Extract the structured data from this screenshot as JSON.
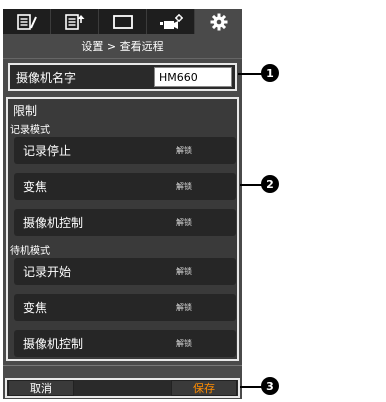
{
  "tabs": [
    {
      "icon": "list-edit-icon"
    },
    {
      "icon": "list-upload-icon"
    },
    {
      "icon": "monitor-icon"
    },
    {
      "icon": "camera-settings-icon"
    },
    {
      "icon": "gear-icon"
    }
  ],
  "breadcrumb": {
    "settings": "设置",
    "separator": " > ",
    "page": "查看远程"
  },
  "camera_name": {
    "label": "摄像机名字",
    "value": "HM660"
  },
  "limits": {
    "title": "限制",
    "record_mode": {
      "label": "记录模式",
      "items": [
        {
          "name": "记录停止",
          "value": "解锁"
        },
        {
          "name": "变焦",
          "value": "解锁"
        },
        {
          "name": "摄像机控制",
          "value": "解锁"
        }
      ]
    },
    "standby_mode": {
      "label": "待机模式",
      "items": [
        {
          "name": "记录开始",
          "value": "解锁"
        },
        {
          "name": "变焦",
          "value": "解锁"
        },
        {
          "name": "摄像机控制",
          "value": "解锁"
        }
      ]
    }
  },
  "buttons": {
    "cancel": "取消",
    "save": "保存"
  },
  "callouts": [
    "1",
    "2",
    "3"
  ],
  "colors": {
    "save_text": "#ff8c00",
    "background": "#4a4a4a"
  }
}
